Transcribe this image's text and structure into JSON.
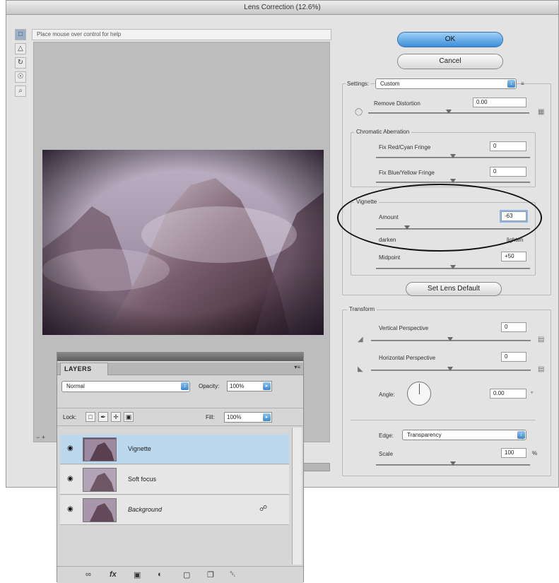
{
  "dialog": {
    "title": "Lens Correction (12.6%)",
    "help_text": "Place mouse over control for help",
    "zoom_label": "− +",
    "tools": [
      "□",
      "△",
      "↻",
      "☉",
      "⌕"
    ]
  },
  "buttons": {
    "ok": "OK",
    "cancel": "Cancel",
    "set_lens_default": "Set Lens Default"
  },
  "settings": {
    "label": "Settings:",
    "value": "Custom",
    "menu_icon": "≡"
  },
  "remove_distortion": {
    "label": "Remove Distortion",
    "value": "0.00"
  },
  "chromatic": {
    "group_label": "Chromatic Aberration",
    "red_cyan": {
      "label": "Fix Red/Cyan Fringe",
      "value": "0"
    },
    "blue_yellow": {
      "label": "Fix Blue/Yellow Fringe",
      "value": "0"
    }
  },
  "vignette": {
    "group_label": "Vignette",
    "amount": {
      "label": "Amount",
      "value": "-63"
    },
    "darken": "darken",
    "lighten": "lighten",
    "midpoint": {
      "label": "Midpoint",
      "value": "+50"
    }
  },
  "transform": {
    "group_label": "Transform",
    "vertical": {
      "label": "Vertical Perspective",
      "value": "0"
    },
    "horizontal": {
      "label": "Horizontal Perspective",
      "value": "0"
    },
    "angle": {
      "label": "Angle:",
      "value": "0.00",
      "unit": "°"
    },
    "edge": {
      "label": "Edge:",
      "value": "Transparency"
    },
    "scale": {
      "label": "Scale",
      "value": "100",
      "unit": "%"
    }
  },
  "layers_panel": {
    "tab": "LAYERS",
    "menu": "▾≡",
    "blend_mode": "Normal",
    "opacity_label": "Opacity:",
    "opacity_value": "100%",
    "lock_label": "Lock:",
    "fill_label": "Fill:",
    "fill_value": "100%",
    "layers": [
      {
        "name": "Vignette"
      },
      {
        "name": "Soft focus"
      },
      {
        "name": "Background"
      }
    ],
    "bottom_icons": [
      "∞",
      "fx",
      "▣",
      "◐",
      "▢",
      "❐",
      "␡"
    ]
  },
  "colors": {
    "accent": "#3c8ed8",
    "selected_layer": "#bcd8ef"
  }
}
